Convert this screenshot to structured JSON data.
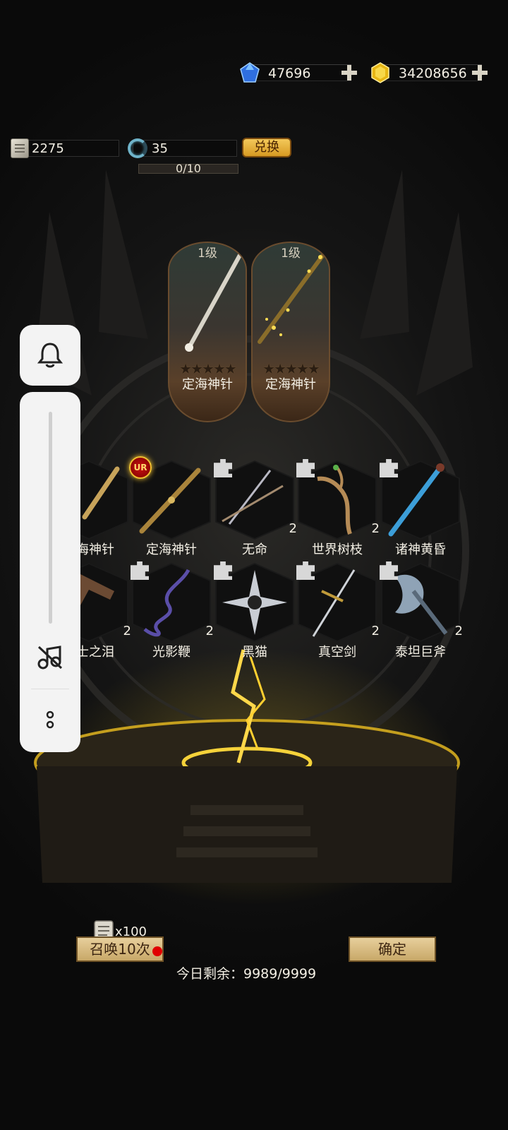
{
  "currencies": {
    "diamonds": "47696",
    "gold": "34208656"
  },
  "resources": {
    "scrolls": "2275",
    "tokens": "35",
    "exchange_label": "兑换",
    "progress_text": "0/10",
    "progress": 0
  },
  "featured": [
    {
      "level": "1级",
      "stars": "★★★★★",
      "name": "定海神针"
    },
    {
      "level": "1级",
      "stars": "★★★★★",
      "name": "定海神针"
    }
  ],
  "grid": [
    {
      "name": "定海神针",
      "count": "",
      "badge": ""
    },
    {
      "name": "定海神针",
      "count": "",
      "badge": "UR"
    },
    {
      "name": "无命",
      "count": "2",
      "badge": "puzzle"
    },
    {
      "name": "世界树枝",
      "count": "2",
      "badge": "puzzle"
    },
    {
      "name": "诸神黄昏",
      "count": "",
      "badge": "puzzle"
    },
    {
      "name": "骑士之泪",
      "count": "2",
      "badge": ""
    },
    {
      "name": "光影鞭",
      "count": "2",
      "badge": "puzzle"
    },
    {
      "name": "黑猫",
      "count": "",
      "badge": "puzzle"
    },
    {
      "name": "真空剑",
      "count": "2",
      "badge": "puzzle"
    },
    {
      "name": "泰坦巨斧",
      "count": "2",
      "badge": "puzzle"
    }
  ],
  "summon": {
    "cost": "x100",
    "summon10_label": "召唤10次",
    "remaining_text": "今日剩余：9989/9999",
    "confirm_label": "确定"
  },
  "icons": {
    "diamond": "blue-gem-icon",
    "gold": "gold-gem-icon",
    "scroll": "scroll-icon",
    "token": "ring-icon",
    "bell": "bell-icon",
    "music_off": "music-off-icon",
    "more": "more-icon"
  },
  "colors": {
    "accent_gold": "#d79a22",
    "panel_white": "#f3f3f3",
    "red_dot": "#e00000"
  }
}
